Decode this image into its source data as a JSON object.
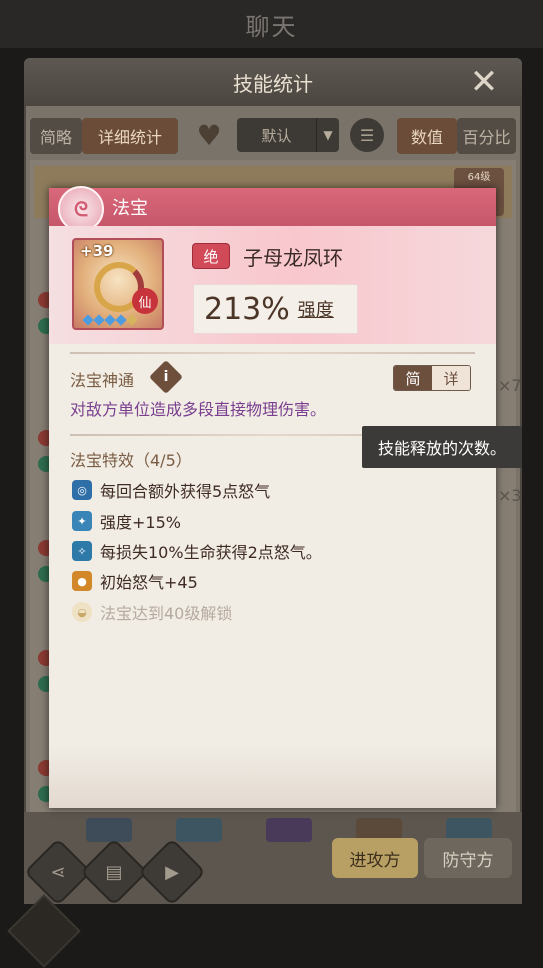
{
  "chat_title": "聊天",
  "stats_panel": {
    "title": "技能统计",
    "tabs": [
      "简略",
      "详细统计"
    ],
    "sort_value": "默认",
    "mode_tabs": [
      "数值",
      "百分比"
    ],
    "attack_label": "进攻方",
    "defense_label": "防守方",
    "level_tag": "64级",
    "count_1": "×7",
    "count_2": "×3"
  },
  "popup": {
    "header": "法宝",
    "item": {
      "level_bonus": "+39",
      "grade": "绝",
      "name": "子母龙凤环",
      "power_value": "213%",
      "power_label": "强度",
      "xian_label": "仙"
    },
    "skill": {
      "title": "法宝神通",
      "info_glyph": "i",
      "toggle": [
        "简",
        "详"
      ],
      "description": "对敌方单位造成多段直接物理伤害。"
    },
    "effects": {
      "title": "法宝特效（4/5）",
      "items": [
        {
          "text": "每回合额外获得5点怒气",
          "icon": "swirl-icon",
          "color": "#2e6fa8"
        },
        {
          "text": "强度+15%",
          "icon": "crystal-fist-icon",
          "color": "#3a85b7"
        },
        {
          "text": "每损失10%生命获得2点怒气。",
          "icon": "spark-icon",
          "color": "#2d7aa8"
        },
        {
          "text": "初始怒气+45",
          "icon": "flame-orb-icon",
          "color": "#d28728"
        }
      ],
      "locked": {
        "text": "法宝达到40级解锁",
        "icon": "lock-icon"
      }
    }
  },
  "tooltip": "技能释放的次数。",
  "colors": {
    "popup_header": "#d9687a",
    "skill_desc": "#7a3f8f",
    "accent_brown": "#6d4f3e"
  }
}
